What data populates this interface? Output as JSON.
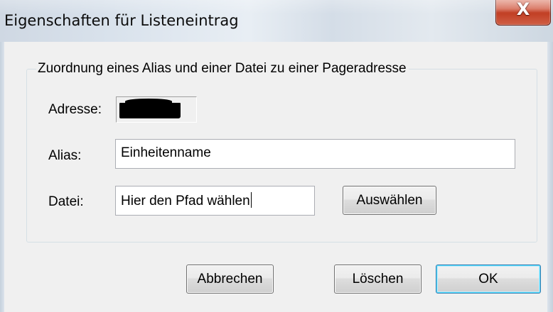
{
  "window": {
    "title": "Eigenschaften für Listeneintrag",
    "close_symbol": "X"
  },
  "group": {
    "title": "Zuordnung eines Alias und einer Datei zu einer Pageradresse"
  },
  "fields": {
    "address_label": "Adresse:",
    "alias_label": "Alias:",
    "alias_value": "Einheitenname",
    "file_label": "Datei:",
    "file_value": "Hier den Pfad wählen"
  },
  "buttons": {
    "browse": "Auswählen",
    "cancel": "Abbrechen",
    "delete": "Löschen",
    "ok": "OK"
  },
  "icons": {
    "close": "close-icon"
  },
  "colors": {
    "dialog_background": "#f0f0f0",
    "close_button_red": "#c13d22",
    "default_button_border": "#3c7fb1"
  }
}
